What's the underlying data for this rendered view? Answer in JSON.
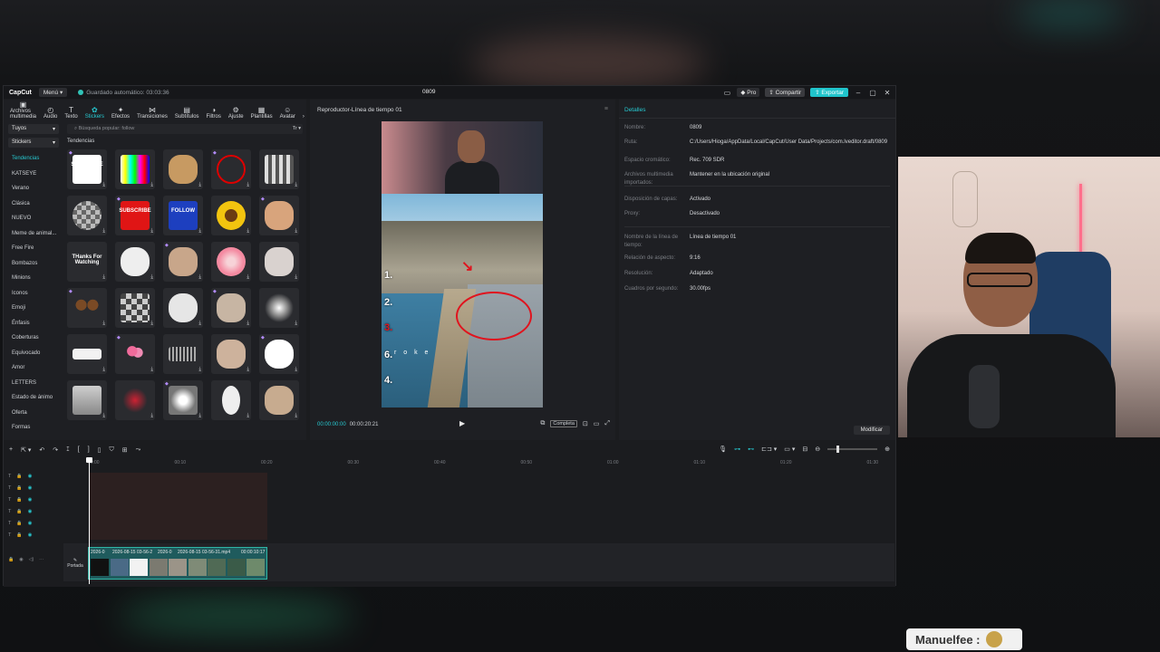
{
  "window": {
    "logo": "CapCut",
    "menu": "Menú",
    "autosave": "Guardado automático: 03:03:36",
    "title": "0809",
    "pro": "Pro",
    "share": "Compartir",
    "export": "Exportar"
  },
  "toolbar": [
    {
      "label": "Archivos multimedia",
      "icon": "media-icon"
    },
    {
      "label": "Audio",
      "icon": "audio-icon"
    },
    {
      "label": "Texto",
      "icon": "text-icon"
    },
    {
      "label": "Stickers",
      "icon": "stickers-icon",
      "active": true
    },
    {
      "label": "Efectos",
      "icon": "effects-icon"
    },
    {
      "label": "Transiciones",
      "icon": "transitions-icon"
    },
    {
      "label": "Subtítulos",
      "icon": "subtitles-icon"
    },
    {
      "label": "Filtros",
      "icon": "filters-icon"
    },
    {
      "label": "Ajuste",
      "icon": "adjust-icon"
    },
    {
      "label": "Plantillas",
      "icon": "templates-icon"
    },
    {
      "label": "Avatar",
      "icon": "avatar-icon"
    }
  ],
  "sidebar": {
    "tuyos": "Tuyos",
    "stickers": "Stickers",
    "items": [
      "Tendencias",
      "KATSEYE",
      "Verano",
      "Clásica",
      "NUEVO",
      "Meme de animal...",
      "Free Fire",
      "Bombazos",
      "Minions",
      "Iconos",
      "Emoji",
      "Énfasis",
      "Coberturas",
      "Equivocado",
      "Amor",
      "LETTERS",
      "Estado de ánimo",
      "Oferta",
      "Formas"
    ]
  },
  "search": {
    "placeholder": "Búsqueda popular: follow"
  },
  "trending_label": "Tendencias",
  "stickers": [
    {
      "kind": "subscribe-bar",
      "text": "SUBSCRIBE"
    },
    {
      "kind": "tv-colorbars",
      "text": ""
    },
    {
      "kind": "cat",
      "text": ""
    },
    {
      "kind": "red-scribble",
      "text": ""
    },
    {
      "kind": "pixel-bar",
      "text": ""
    },
    {
      "kind": "pixel-blur",
      "text": ""
    },
    {
      "kind": "subscribe-button",
      "text": "SUBSCRIBE"
    },
    {
      "kind": "follow-button",
      "text": "FOLLOW"
    },
    {
      "kind": "sunflower",
      "text": ""
    },
    {
      "kind": "cat-kiss",
      "text": ""
    },
    {
      "kind": "thanks-text",
      "text": "THanks For Watching"
    },
    {
      "kind": "skull-cat",
      "text": ""
    },
    {
      "kind": "cat-heart",
      "text": ""
    },
    {
      "kind": "hibiscus",
      "text": ""
    },
    {
      "kind": "cat-flowers",
      "text": ""
    },
    {
      "kind": "dog-ears",
      "text": ""
    },
    {
      "kind": "pixel-mosaic",
      "text": ""
    },
    {
      "kind": "cowboy-skull",
      "text": ""
    },
    {
      "kind": "cat-bandage",
      "text": ""
    },
    {
      "kind": "glow-orb",
      "text": ""
    },
    {
      "kind": "white-brush",
      "text": ""
    },
    {
      "kind": "tulips",
      "text": ""
    },
    {
      "kind": "audio-wave",
      "text": ""
    },
    {
      "kind": "cat-cry",
      "text": ""
    },
    {
      "kind": "cloud-face",
      "text": ""
    },
    {
      "kind": "paper-texture",
      "text": ""
    },
    {
      "kind": "bow",
      "text": ""
    },
    {
      "kind": "lily",
      "text": ""
    },
    {
      "kind": "skull",
      "text": ""
    },
    {
      "kind": "cat-sign",
      "text": ""
    }
  ],
  "player": {
    "title": "Reproductor-Línea de tiempo 01",
    "current": "00:00:00:00",
    "total": "00:00:20:21",
    "compare": "Completa",
    "nums": [
      "1.",
      "2.",
      "3.",
      "6.",
      "4."
    ],
    "stroke_text": "r o k e"
  },
  "details": {
    "header": "Detalles",
    "rows": [
      {
        "label": "Nombre:",
        "value": "0809"
      },
      {
        "label": "Ruta:",
        "value": "C:/Users/Hioga/AppData/Local/CapCut/User Data/Projects/com.lveditor.draft/0809"
      },
      {
        "label": "Espacio cromático:",
        "value": "Rec. 709 SDR"
      },
      {
        "label": "Archivos multimedia importados:",
        "value": "Mantener en la ubicación original"
      },
      {
        "label": "Disposición de capas:",
        "value": "Activado"
      },
      {
        "label": "Proxy:",
        "value": "Desactivado"
      },
      {
        "label": "Nombre de la línea de tiempo:",
        "value": "Línea de tiempo 01"
      },
      {
        "label": "Relación de aspecto:",
        "value": "9:16"
      },
      {
        "label": "Resolución:",
        "value": "Adaptado"
      },
      {
        "label": "Cuadros por segundo:",
        "value": "30.00fps"
      }
    ],
    "modify": "Modificar"
  },
  "timeline": {
    "ruler": [
      "00:00",
      "00:10",
      "00:20",
      "00:30",
      "00:40",
      "00:50",
      "01:00",
      "01:10",
      "01:20",
      "01:30"
    ],
    "portada": "Portada",
    "clips": [
      "2026-0",
      "2026-08-15 03-56-2",
      "2026-0",
      "2026-08-15 03-56-31.mp4",
      "00:00:10:17"
    ]
  },
  "chat": {
    "name": "Manuelfee :"
  },
  "colors": {
    "accent": "#27c9d1",
    "export": "#20c4cb",
    "timeline_clip": "#1f5b5d"
  }
}
